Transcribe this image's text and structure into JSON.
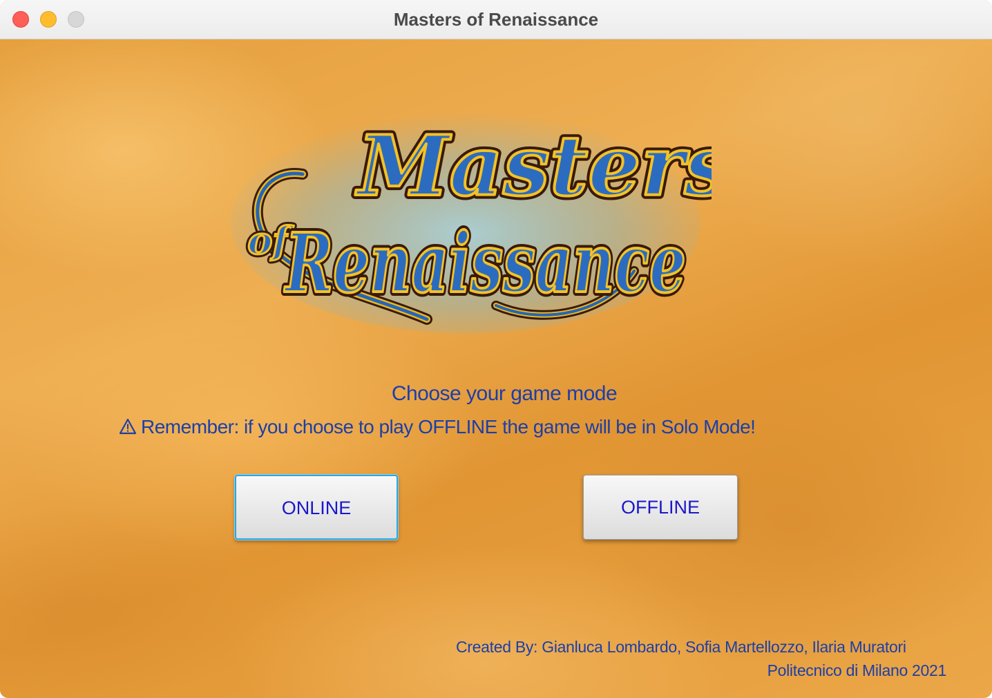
{
  "window": {
    "title": "Masters of Renaissance"
  },
  "logo": {
    "line1": "Masters",
    "of": "of",
    "line2": "Renaissance"
  },
  "menu": {
    "heading": "Choose your game mode",
    "warning": "Remember: if you choose to play OFFLINE the game will be in Solo Mode!",
    "online_label": "ONLINE",
    "offline_label": "OFFLINE"
  },
  "footer": {
    "credits": "Created By: Gianluca Lombardo, Sofia Martellozzo, Ilaria Muratori",
    "university": "Politecnico di Milano 2021"
  },
  "colors": {
    "text_blue": "#1c3fa8",
    "button_text": "#1b18c8",
    "focus_ring": "#2aa6dd",
    "background": "#e9a33c"
  },
  "icons": {
    "warning": "warning-triangle-icon"
  }
}
